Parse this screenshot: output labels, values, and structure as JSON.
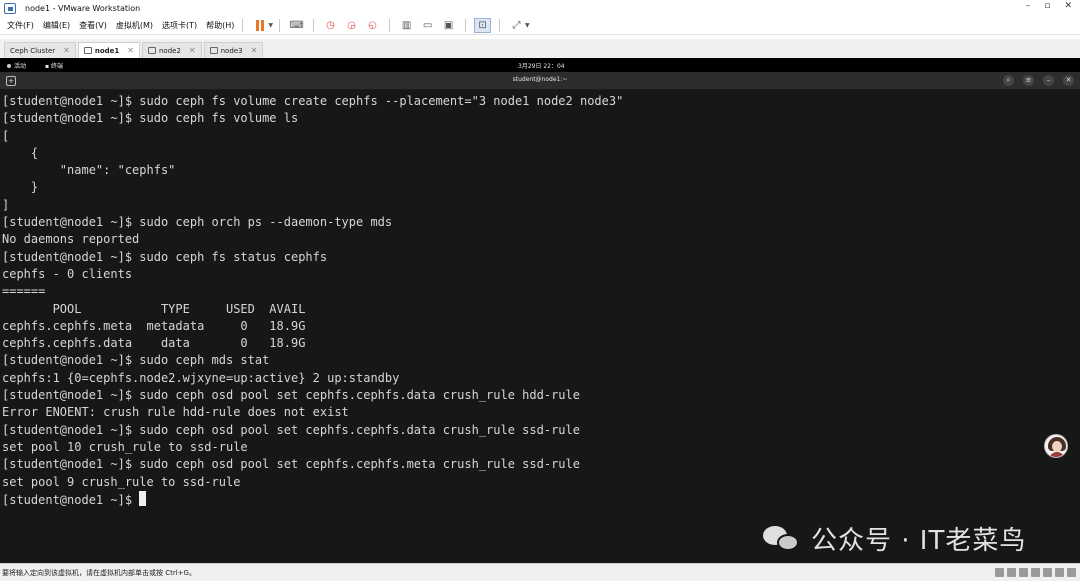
{
  "window": {
    "title": "node1 - VMware Workstation",
    "controls": [
      "–",
      "▫",
      "✕"
    ]
  },
  "menu": [
    "文件(F)",
    "编辑(E)",
    "查看(V)",
    "虚拟机(M)",
    "选项卡(T)",
    "帮助(H)"
  ],
  "toolbar": {
    "icons": [
      "pause-icon",
      "send-keys-icon",
      "snapshot-icon",
      "revert-snapshot-icon",
      "snapshot-manager-icon",
      "sidebar-icon",
      "thumbnail-icon",
      "view-icon",
      "console-icon",
      "fullscreen-icon"
    ]
  },
  "tabs": [
    {
      "label": "Ceph Cluster",
      "active": false
    },
    {
      "label": "node1",
      "active": true
    },
    {
      "label": "node2",
      "active": false
    },
    {
      "label": "node3",
      "active": false
    }
  ],
  "guest_bar": {
    "activities": "活动",
    "app": "终端",
    "clock": "3月29日 22：04"
  },
  "terminal": {
    "title": "student@node1:~",
    "new_tab": "+",
    "controls": [
      "⌕",
      "≡",
      "–",
      "✕"
    ],
    "lines": [
      "[student@node1 ~]$ sudo ceph fs volume create cephfs --placement=\"3 node1 node2 node3\"",
      "[student@node1 ~]$ sudo ceph fs volume ls",
      "[",
      "    {",
      "        \"name\": \"cephfs\"",
      "    }",
      "]",
      "[student@node1 ~]$ sudo ceph orch ps --daemon-type mds",
      "No daemons reported",
      "[student@node1 ~]$ sudo ceph fs status cephfs",
      "cephfs - 0 clients",
      "======",
      "       POOL           TYPE     USED  AVAIL",
      "cephfs.cephfs.meta  metadata     0   18.9G",
      "cephfs.cephfs.data    data       0   18.9G",
      "[student@node1 ~]$ sudo ceph mds stat",
      "cephfs:1 {0=cephfs.node2.wjxyne=up:active} 2 up:standby",
      "[student@node1 ~]$ sudo ceph osd pool set cephfs.cephfs.data crush_rule hdd-rule",
      "Error ENOENT: crush rule hdd-rule does not exist",
      "[student@node1 ~]$ sudo ceph osd pool set cephfs.cephfs.data crush_rule ssd-rule",
      "set pool 10 crush_rule to ssd-rule",
      "[student@node1 ~]$ sudo ceph osd pool set cephfs.cephfs.meta crush_rule ssd-rule",
      "set pool 9 crush_rule to ssd-rule"
    ],
    "prompt": "[student@node1 ~]$ "
  },
  "watermark": "公众号 · IT老菜鸟",
  "status_bar": "要将输入定向到该虚拟机，请在虚拟机内部单击或按 Ctrl+G。"
}
